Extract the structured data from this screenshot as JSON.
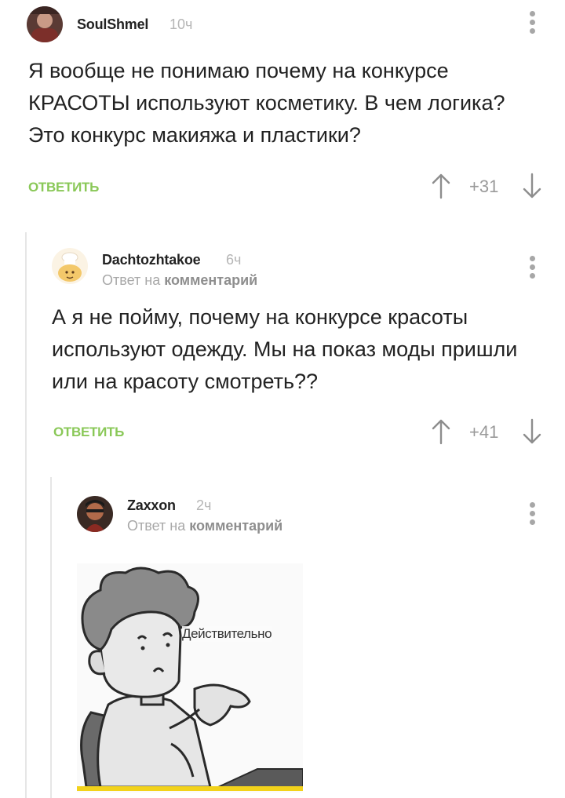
{
  "comments": [
    {
      "user": "SoulShmel",
      "time": "10ч",
      "text": "Я вообще не понимаю почему на конкурсе КРАСОТЫ используют косметику. В чем логика? Это конкурс макияжа и пластики?",
      "reply_label": "ОТВЕТИТЬ",
      "rating": "+31"
    },
    {
      "user": "Dachtozhtakoe",
      "time": "6ч",
      "reply_prefix": "Ответ на",
      "reply_target": "комментарий",
      "text": "А я не пойму, почему на конкурсе красоты используют одежду. Мы на показ моды пришли или на красоту смотреть??",
      "reply_label": "ОТВЕТИТЬ",
      "rating": "+41"
    },
    {
      "user": "Zaxxon",
      "time": "2ч",
      "reply_prefix": "Ответ на",
      "reply_target": "комментарий",
      "image_caption": "Действительно"
    }
  ],
  "colors": {
    "accent_green": "#8ac858",
    "muted": "#a8a8a8",
    "thread_line": "#e6e6e6",
    "meme_stripe": "#f2d21b"
  },
  "icons": [
    "menu-dots-icon",
    "upvote-arrow-icon",
    "downvote-arrow-icon",
    "avatar-icon"
  ]
}
